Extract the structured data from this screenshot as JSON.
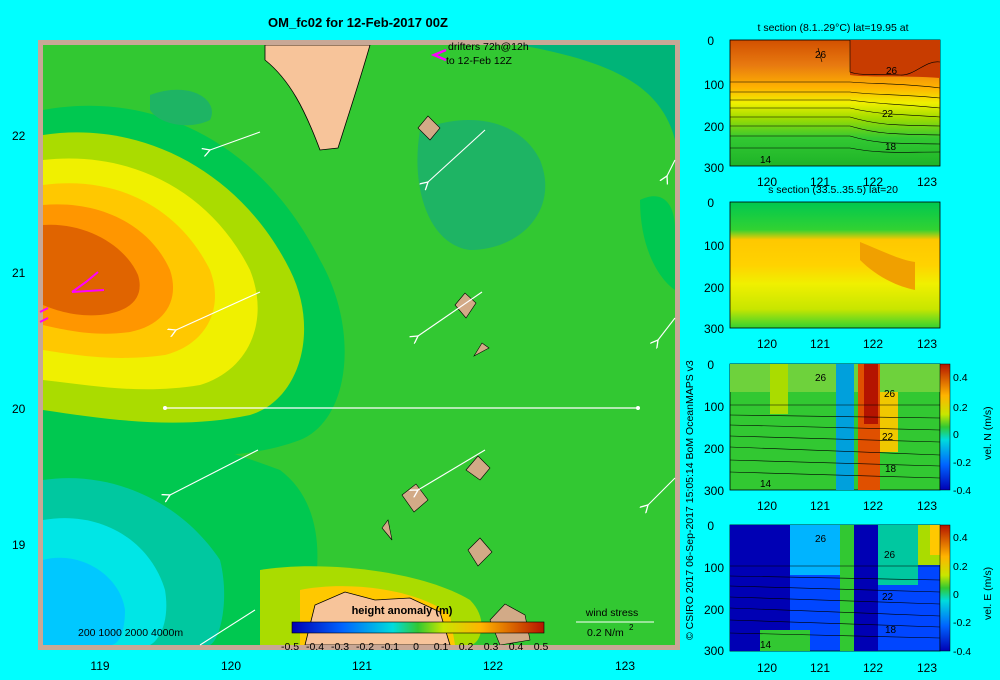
{
  "title": "OM_fc02 for 12-Feb-2017 00Z",
  "colors": {
    "background": "#00ffff",
    "frame": "#c8a896",
    "land": "#f7c49a",
    "drifter": "#ff00ff",
    "anomaly_scale": [
      "#0000b4",
      "#0046ff",
      "#00b4ff",
      "#00e6e6",
      "#00c8a0",
      "#00c850",
      "#32d232",
      "#aadc00",
      "#f0f000",
      "#ffc800",
      "#ff8c00",
      "#e05000",
      "#b41400"
    ]
  },
  "main_map": {
    "lat_ticks": [
      "22",
      "21",
      "20",
      "19"
    ],
    "lon_ticks": [
      "119",
      "120",
      "121",
      "122",
      "123"
    ],
    "drifters_label_line1": "drifters 72h@12h",
    "drifters_label_line2": "to 12-Feb 12Z",
    "depth_legend": "200  1000  2000  4000m",
    "colorbar_title": "height anomaly (m)",
    "colorbar_ticks": [
      "-0.5",
      "-0.4",
      "-0.3",
      "-0.2",
      "-0.1",
      "0",
      "0.1",
      "0.2",
      "0.3",
      "0.4",
      "0.5"
    ],
    "wind_stress_label": "wind stress",
    "wind_stress_scale": "0.2 N/m",
    "wind_stress_exponent": "2"
  },
  "credit": "© CSIRO 2017   06-Sep-2017 15:05:14 BoM OceanMAPS v3",
  "sections": [
    {
      "title": "t section (8.1..29°C) lat=19.95 at",
      "y_ticks": [
        "0",
        "100",
        "200",
        "300"
      ],
      "x_ticks": [
        "120",
        "121",
        "122",
        "123"
      ],
      "contour_labels": [
        "26",
        "26",
        "22",
        "18",
        "14"
      ],
      "colorbar": null
    },
    {
      "title": "s section (33.5..35.5) lat=20",
      "y_ticks": [
        "0",
        "100",
        "200",
        "300"
      ],
      "x_ticks": [
        "120",
        "121",
        "122",
        "123"
      ],
      "contour_labels": [],
      "colorbar": null
    },
    {
      "title": "",
      "y_ticks": [
        "0",
        "100",
        "200",
        "300"
      ],
      "x_ticks": [
        "120",
        "121",
        "122",
        "123"
      ],
      "contour_labels": [
        "26",
        "26",
        "22",
        "18",
        "14"
      ],
      "colorbar": {
        "label": "vel. N (m/s)",
        "ticks": [
          "0.4",
          "0.2",
          "0",
          "-0.2",
          "-0.4"
        ]
      }
    },
    {
      "title": "",
      "y_ticks": [
        "0",
        "100",
        "200",
        "300"
      ],
      "x_ticks": [
        "120",
        "121",
        "122",
        "123"
      ],
      "contour_labels": [
        "26",
        "26",
        "22",
        "18",
        "14"
      ],
      "colorbar": {
        "label": "vel. E (m/s)",
        "ticks": [
          "0.4",
          "0.2",
          "0",
          "-0.2",
          "-0.4"
        ]
      }
    }
  ]
}
